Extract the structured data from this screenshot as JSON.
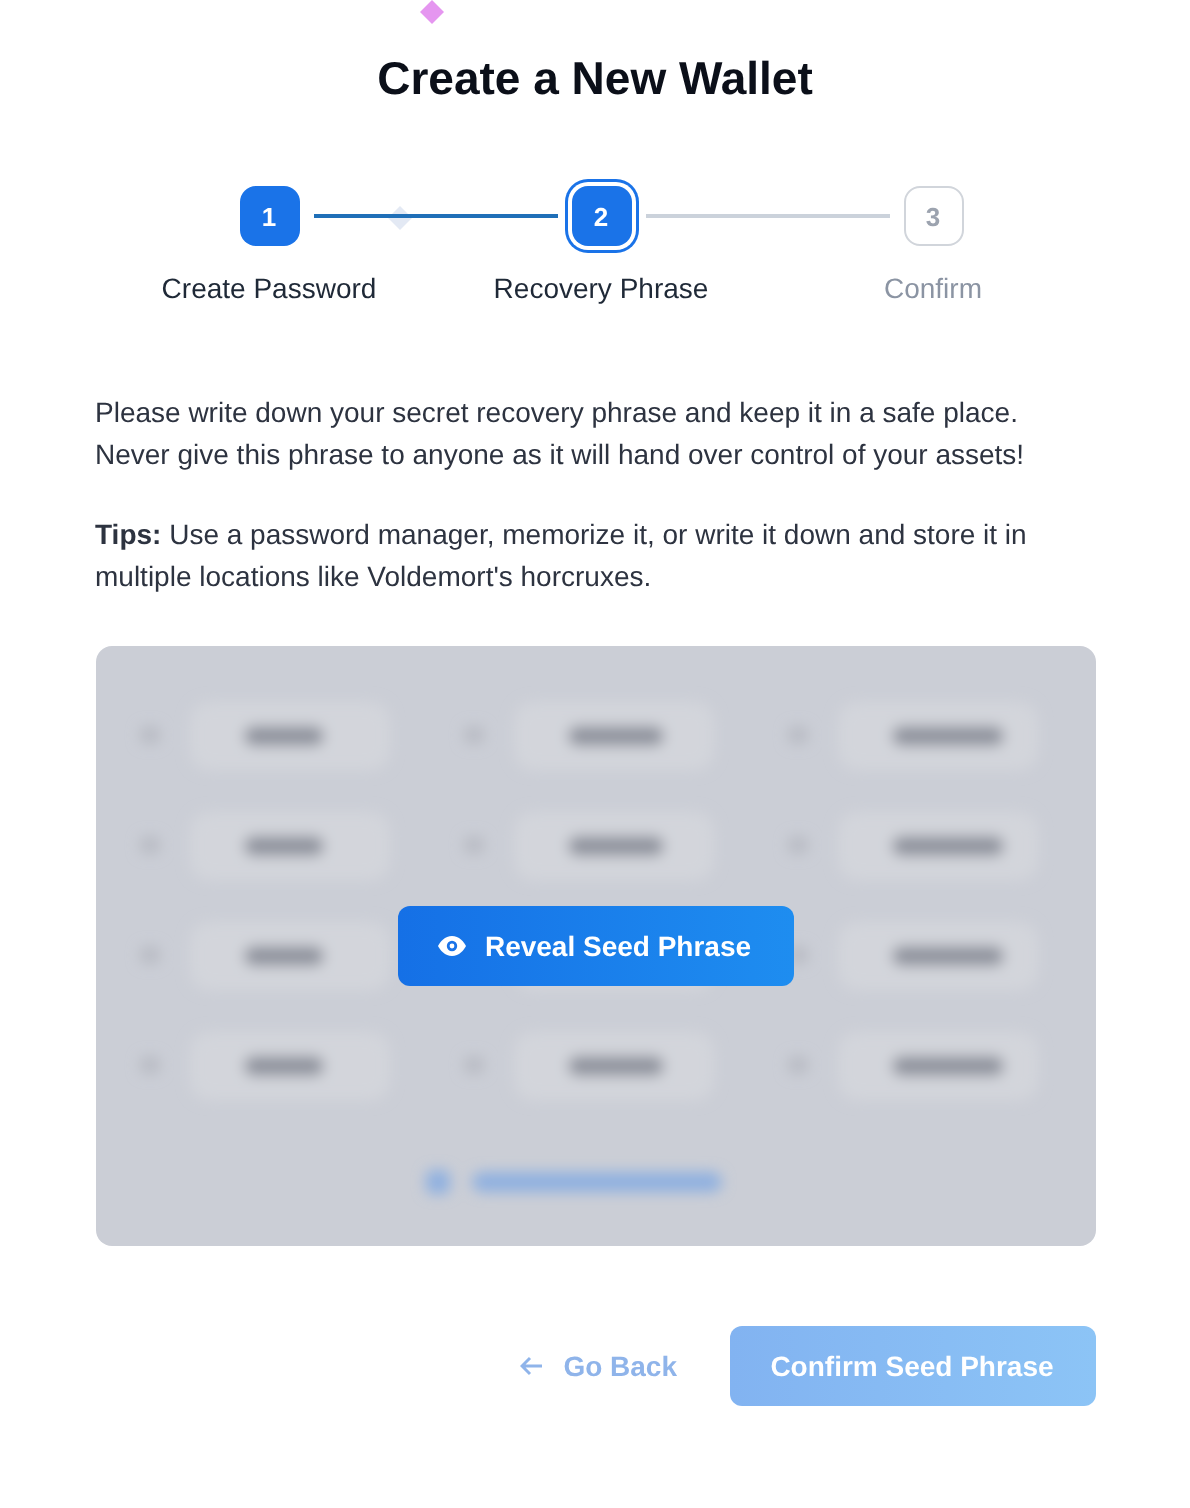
{
  "title": "Create a New Wallet",
  "steps": [
    {
      "number": "1",
      "label": "Create Password",
      "kind": "done"
    },
    {
      "number": "2",
      "label": "Recovery Phrase",
      "kind": "current"
    },
    {
      "number": "3",
      "label": "Confirm",
      "kind": "pending"
    }
  ],
  "instructions": "Please write down your secret recovery phrase and keep it in a safe place. Never give this phrase to anyone as it will hand over control of your assets!",
  "tips": "**Tips:** Use a password manager, memorize it, or write it down and store it in multiple locations like Voldemort's horcruxes.",
  "seed_panel": {
    "hidden": true,
    "reveal_button": "Reveal Seed Phrase"
  },
  "actions": {
    "back": "Go Back",
    "confirm": "Confirm Seed Phrase",
    "confirm_disabled": true
  }
}
